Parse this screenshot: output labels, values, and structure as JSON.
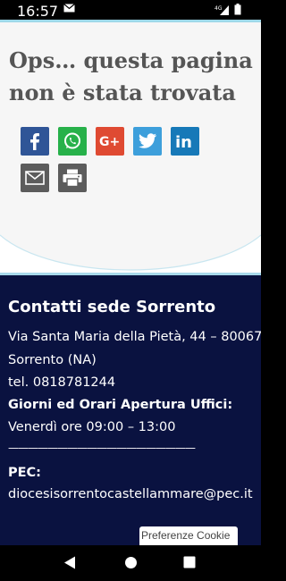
{
  "status": {
    "time": "16:57",
    "network": "4G"
  },
  "hero": {
    "title": "Ops… questa pagina non è stata trovata"
  },
  "share": {
    "buttons": [
      {
        "icon": "facebook-icon",
        "glyph": "f",
        "color": "#2f5597"
      },
      {
        "icon": "whatsapp-icon",
        "glyph": "☎",
        "color": "#27b14a"
      },
      {
        "icon": "google-plus-icon",
        "glyph": "G+",
        "color": "#df4a32"
      },
      {
        "icon": "twitter-icon",
        "glyph": "❦",
        "color": "#3d9fdb"
      },
      {
        "icon": "linkedin-icon",
        "glyph": "in",
        "color": "#1779b8"
      },
      {
        "icon": "email-icon",
        "glyph": "✉",
        "color": "#5c5c5c"
      },
      {
        "icon": "print-icon",
        "glyph": "⎙",
        "color": "#5c5c5c"
      }
    ]
  },
  "footer": {
    "title": "Contatti sede Sorrento",
    "address_line1": "Via Santa Maria della Pietà, 44 – 80067",
    "address_line2": "Sorrento (NA)",
    "phone": "tel. 0818781244",
    "hours_heading": "Giorni ed Orari Apertura Uffici:",
    "hours": "Venerdì ore 09:00 – 13:00",
    "divider": "———————————————————",
    "pec_label": "PEC:",
    "pec_email": "diocesisorrentocastellammare@pec.it"
  },
  "cookie": {
    "label": "Preferenze Cookie"
  },
  "colors": {
    "footer_bg": "#0a1240",
    "accent": "#a8d9ea"
  }
}
